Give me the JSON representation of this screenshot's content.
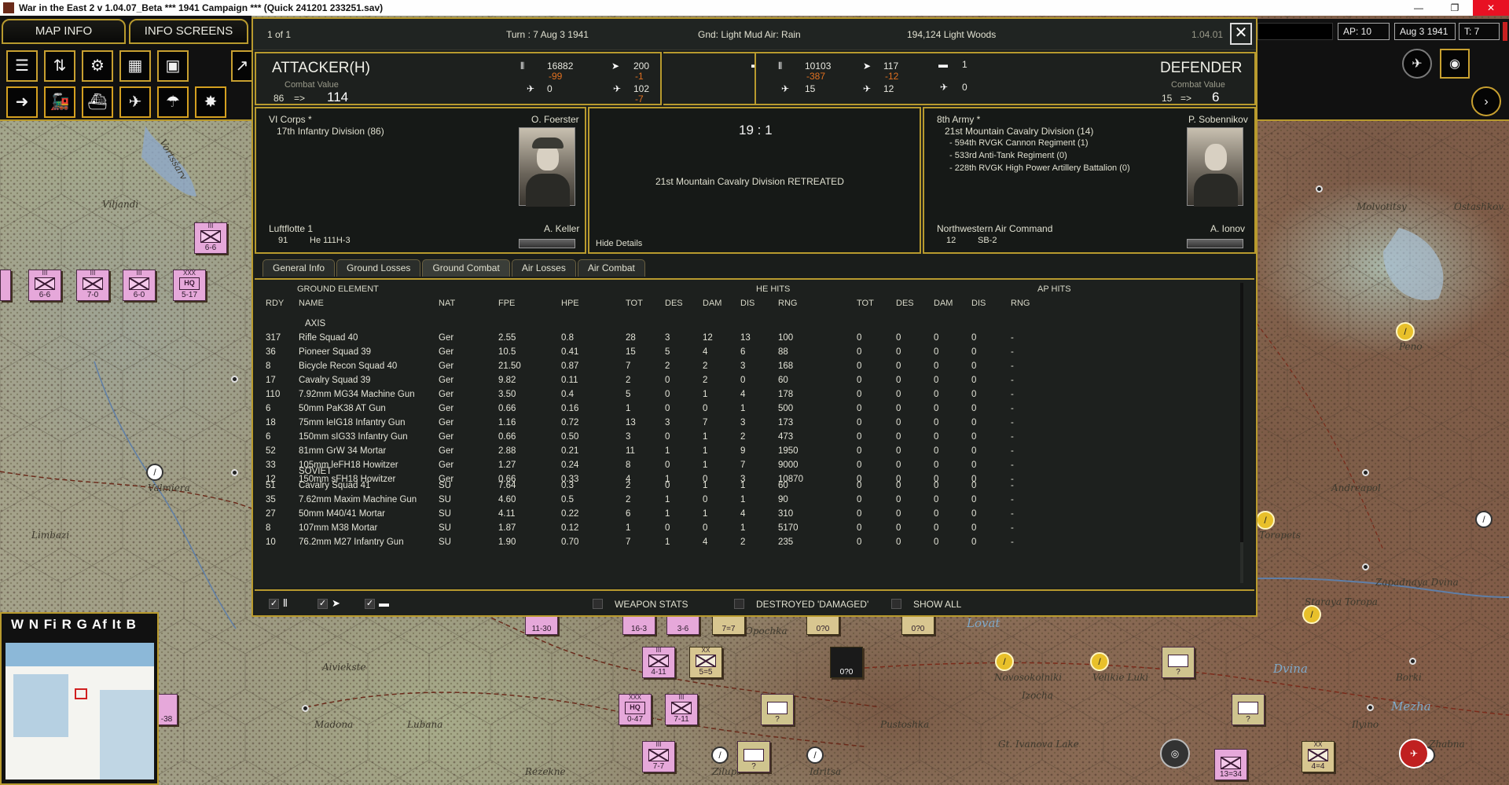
{
  "titlebar": {
    "title": "War in the East 2  v 1.04.07_Beta    ***  1941 Campaign  ***  (Quick 241201 233251.sav)",
    "minimize": "—",
    "restore": "❐",
    "close": "✕"
  },
  "topnav": {
    "map_info": "MAP INFO",
    "info_screens": "INFO SCREENS"
  },
  "topright": {
    "ap": "AP: 10",
    "date": "Aug 3 1941",
    "turn": "T: 7"
  },
  "toolbar": {
    "row1_icons": [
      "orders-icon",
      "logistics-icon",
      "gear-icon",
      "chart-icon",
      "report-icon"
    ],
    "row2_icons": [
      "move-icon",
      "train-icon",
      "naval-icon",
      "airbase-icon",
      "paradrop-icon",
      "artillery-icon"
    ]
  },
  "combat": {
    "page": "1 of 1",
    "turn": "Turn : 7   Aug 3 1941",
    "weather": "Gnd: Light Mud  Air: Rain",
    "location": "194,124   Light Woods",
    "version": "1.04.01",
    "attacker": {
      "role": "ATTACKER(H)",
      "cv_label": "Combat Value",
      "cv_old": "86",
      "cv_arrow": "=>",
      "cv_new": "114",
      "men": "16882",
      "men_loss": "-99",
      "guns": "0",
      "afv": "0",
      "aircraft": "200",
      "aircraft_loss": "-1",
      "air_eff": "0",
      "bombers": "102",
      "bombers_loss": "-7",
      "ac_other": "0",
      "corps": "VI Corps *",
      "unit": "17th Infantry Division (86)",
      "leader": "O. Foerster",
      "air_cmd": "Luftflotte 1",
      "air_count": "91",
      "air_type": "He 111H-3",
      "air_leader": "A. Keller"
    },
    "defender": {
      "role": "DEFENDER",
      "cv_label": "Combat Value",
      "cv_old": "15",
      "cv_arrow": "=>",
      "cv_new": "6",
      "men": "10103",
      "men_loss": "-387",
      "guns": "15",
      "afv": "1",
      "aircraft": "117",
      "aircraft_loss": "-12",
      "bombers": "12",
      "ac_other": "0",
      "army": "8th Army *",
      "unit": "21st Mountain Cavalry Division (14)",
      "attached": [
        "- 594th RVGK Cannon Regiment (1)",
        "- 533rd Anti-Tank Regiment (0)",
        "- 228th RVGK High Power Artillery Battalion (0)"
      ],
      "leader": "P. Sobennikov",
      "air_cmd": "Northwestern Air Command",
      "air_count": "12",
      "air_type": "SB-2",
      "air_leader": "A. Ionov"
    },
    "ratio": "19 : 1",
    "result": "21st Mountain Cavalry Division RETREATED",
    "hide_details": "Hide Details",
    "tabs": [
      "General Info",
      "Ground Losses",
      "Ground Combat",
      "Air Losses",
      "Air Combat"
    ],
    "table": {
      "group_ground": "GROUND ELEMENT",
      "group_he": "HE HITS",
      "group_ap": "AP HITS",
      "columns": [
        "RDY",
        "NAME",
        "NAT",
        "FPE",
        "HPE",
        "TOT",
        "DES",
        "DAM",
        "DIS",
        "RNG",
        "TOT",
        "DES",
        "DAM",
        "DIS",
        "RNG"
      ],
      "axis_label": "AXIS",
      "soviet_label": "SOVIET",
      "axis_rows": [
        [
          "317",
          "Rifle Squad 40",
          "Ger",
          "2.55",
          "0.8",
          "28",
          "3",
          "12",
          "13",
          "100",
          "0",
          "0",
          "0",
          "0",
          "-"
        ],
        [
          "36",
          "Pioneer Squad 39",
          "Ger",
          "10.5",
          "0.41",
          "15",
          "5",
          "4",
          "6",
          "88",
          "0",
          "0",
          "0",
          "0",
          "-"
        ],
        [
          "8",
          "Bicycle Recon Squad 40",
          "Ger",
          "21.50",
          "0.87",
          "7",
          "2",
          "2",
          "3",
          "168",
          "0",
          "0",
          "0",
          "0",
          "-"
        ],
        [
          "17",
          "Cavalry Squad 39",
          "Ger",
          "9.82",
          "0.11",
          "2",
          "0",
          "2",
          "0",
          "60",
          "0",
          "0",
          "0",
          "0",
          "-"
        ],
        [
          "110",
          "7.92mm MG34 Machine Gun",
          "Ger",
          "3.50",
          "0.4",
          "5",
          "0",
          "1",
          "4",
          "178",
          "0",
          "0",
          "0",
          "0",
          "-"
        ],
        [
          "6",
          "50mm PaK38 AT Gun",
          "Ger",
          "0.66",
          "0.16",
          "1",
          "0",
          "0",
          "1",
          "500",
          "0",
          "0",
          "0",
          "0",
          "-"
        ],
        [
          "18",
          "75mm leIG18 Infantry Gun",
          "Ger",
          "1.16",
          "0.72",
          "13",
          "3",
          "7",
          "3",
          "173",
          "0",
          "0",
          "0",
          "0",
          "-"
        ],
        [
          "6",
          "150mm sIG33 Infantry Gun",
          "Ger",
          "0.66",
          "0.50",
          "3",
          "0",
          "1",
          "2",
          "473",
          "0",
          "0",
          "0",
          "0",
          "-"
        ],
        [
          "52",
          "81mm GrW 34 Mortar",
          "Ger",
          "2.88",
          "0.21",
          "11",
          "1",
          "1",
          "9",
          "1950",
          "0",
          "0",
          "0",
          "0",
          "-"
        ],
        [
          "33",
          "105mm leFH18 Howitzer",
          "Ger",
          "1.27",
          "0.24",
          "8",
          "0",
          "1",
          "7",
          "9000",
          "0",
          "0",
          "0",
          "0",
          "-"
        ],
        [
          "12",
          "150mm sFH18 Howitzer",
          "Ger",
          "0.66",
          "0.33",
          "4",
          "1",
          "0",
          "3",
          "10870",
          "0",
          "0",
          "0",
          "0",
          "-"
        ]
      ],
      "soviet_rows": [
        [
          "51",
          "Cavalry Squad 41",
          "SU",
          "7.64",
          "0.3",
          "2",
          "0",
          "1",
          "1",
          "60",
          "0",
          "0",
          "0",
          "0",
          "-"
        ],
        [
          "35",
          "7.62mm Maxim Machine Gun",
          "SU",
          "4.60",
          "0.5",
          "2",
          "1",
          "0",
          "1",
          "90",
          "0",
          "0",
          "0",
          "0",
          "-"
        ],
        [
          "27",
          "50mm M40/41 Mortar",
          "SU",
          "4.11",
          "0.22",
          "6",
          "1",
          "1",
          "4",
          "310",
          "0",
          "0",
          "0",
          "0",
          "-"
        ],
        [
          "8",
          "107mm M38 Mortar",
          "SU",
          "1.87",
          "0.12",
          "1",
          "0",
          "0",
          "1",
          "5170",
          "0",
          "0",
          "0",
          "0",
          "-"
        ],
        [
          "10",
          "76.2mm M27 Infantry Gun",
          "SU",
          "1.90",
          "0.70",
          "7",
          "1",
          "4",
          "2",
          "235",
          "0",
          "0",
          "0",
          "0",
          "-"
        ]
      ]
    },
    "footer": {
      "weapon_stats": "WEAPON STATS",
      "destroyed": "DESTROYED 'DAMAGED'",
      "show_all": "SHOW ALL"
    }
  },
  "map": {
    "labels": [
      "Viljandi",
      "Valmiera",
      "Limbazi",
      "Aiviekste",
      "Madona",
      "Lubana",
      "Rezekne",
      "Zilupe",
      "Idritsa",
      "Pustoshka",
      "Novosokolniki",
      "Velikie Luki",
      "Izocha",
      "Gt. Ivanova Lake",
      "Toropets",
      "Andreapol",
      "Zapadnaya Dvina",
      "Staraya Toropa",
      "Peno",
      "Molvotitsy",
      "Ostashkov",
      "Borki",
      "Ilyino",
      "Zhabna",
      "Opochka",
      "Vortsšarv",
      "Dvina",
      "Lovat",
      "Mezha"
    ],
    "counters": [
      "6-6",
      "6-6",
      "7-0",
      "6-0",
      "5-17",
      "11-30",
      "16-3",
      "3-6",
      "7=7",
      "0?0",
      "0?0",
      "4-11",
      "5=5",
      "0?0",
      "0-47",
      "7-11",
      "7-7",
      "?",
      "?",
      "?",
      "?",
      "4=4",
      "13=34",
      "4",
      "-38"
    ]
  },
  "minimap": {
    "filters": "W N Fi R G Af It B"
  }
}
